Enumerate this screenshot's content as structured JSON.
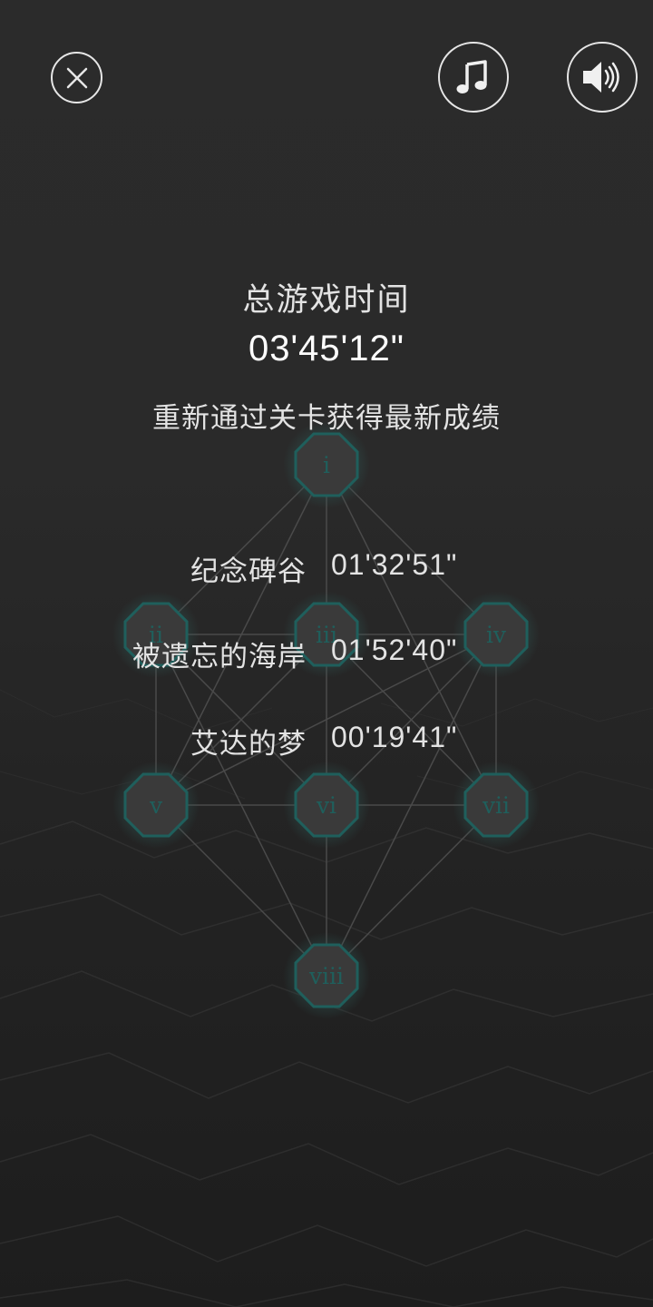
{
  "controls": {
    "close_icon": "close-icon",
    "music_icon": "music-note-icon",
    "sound_icon": "speaker-volume-icon"
  },
  "summary": {
    "total_label": "总游戏时间",
    "total_time": "03'45'12\"",
    "hint": "重新通过关卡获得最新成绩"
  },
  "records": [
    {
      "name": "纪念碑谷",
      "time": "01'32'51\""
    },
    {
      "name": "被遗忘的海岸",
      "time": "01'52'40\""
    },
    {
      "name": "艾达的梦",
      "time": "00'19'41\""
    }
  ],
  "level_map": {
    "nodes": [
      "i",
      "ii",
      "iii",
      "iv",
      "v",
      "vi",
      "vii",
      "viii"
    ]
  },
  "colors": {
    "background": "#262626",
    "node_fill": "#3a3a3a",
    "node_outline": "#1f5f5c",
    "text": "#e3e3e3"
  }
}
